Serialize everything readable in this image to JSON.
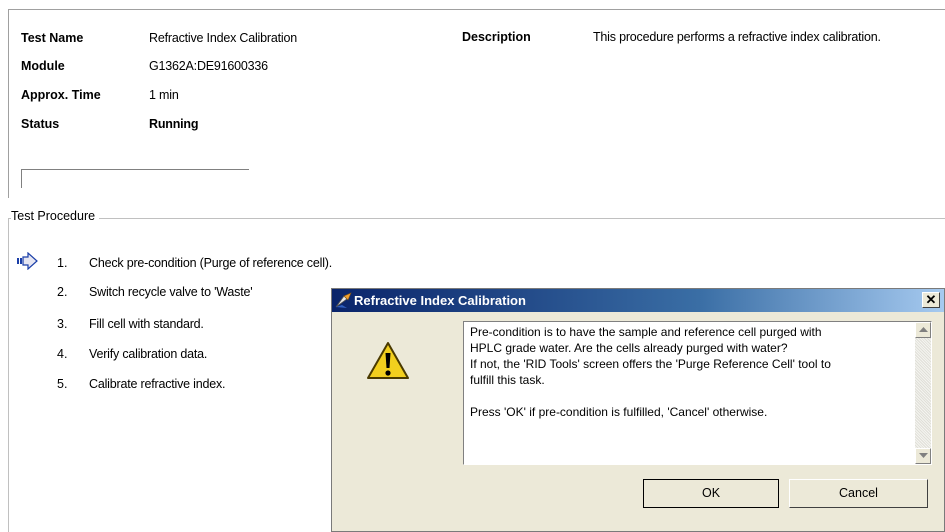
{
  "info": {
    "test_name_label": "Test Name",
    "test_name_value": "Refractive Index Calibration",
    "module_label": "Module",
    "module_value": "G1362A:DE91600336",
    "time_label": "Approx. Time",
    "time_value": "1 min",
    "status_label": "Status",
    "status_value": "Running",
    "description_label": "Description",
    "description_value": "This procedure performs a refractive index calibration."
  },
  "procedure": {
    "title": "Test Procedure",
    "current_icon": "arrow-right-icon",
    "steps": [
      {
        "num": "1.",
        "text": "Check pre-condition (Purge of reference cell)."
      },
      {
        "num": "2.",
        "text": "Switch recycle valve to 'Waste'"
      },
      {
        "num": "3.",
        "text": "Fill cell with standard."
      },
      {
        "num": "4.",
        "text": "Verify calibration data."
      },
      {
        "num": "5.",
        "text": "Calibrate refractive index."
      }
    ]
  },
  "dialog": {
    "title": "Refractive Index Calibration",
    "close_label": "✕",
    "icon": "warning-icon",
    "message": "Pre-condition is to have the sample and reference cell purged with\nHPLC grade water. Are the cells already purged with water?\nIf not, the 'RID Tools' screen offers the 'Purge Reference Cell' tool to\nfulfill this task.\n\nPress 'OK' if pre-condition is fulfilled, 'Cancel' otherwise.",
    "ok_label": "OK",
    "cancel_label": "Cancel"
  }
}
